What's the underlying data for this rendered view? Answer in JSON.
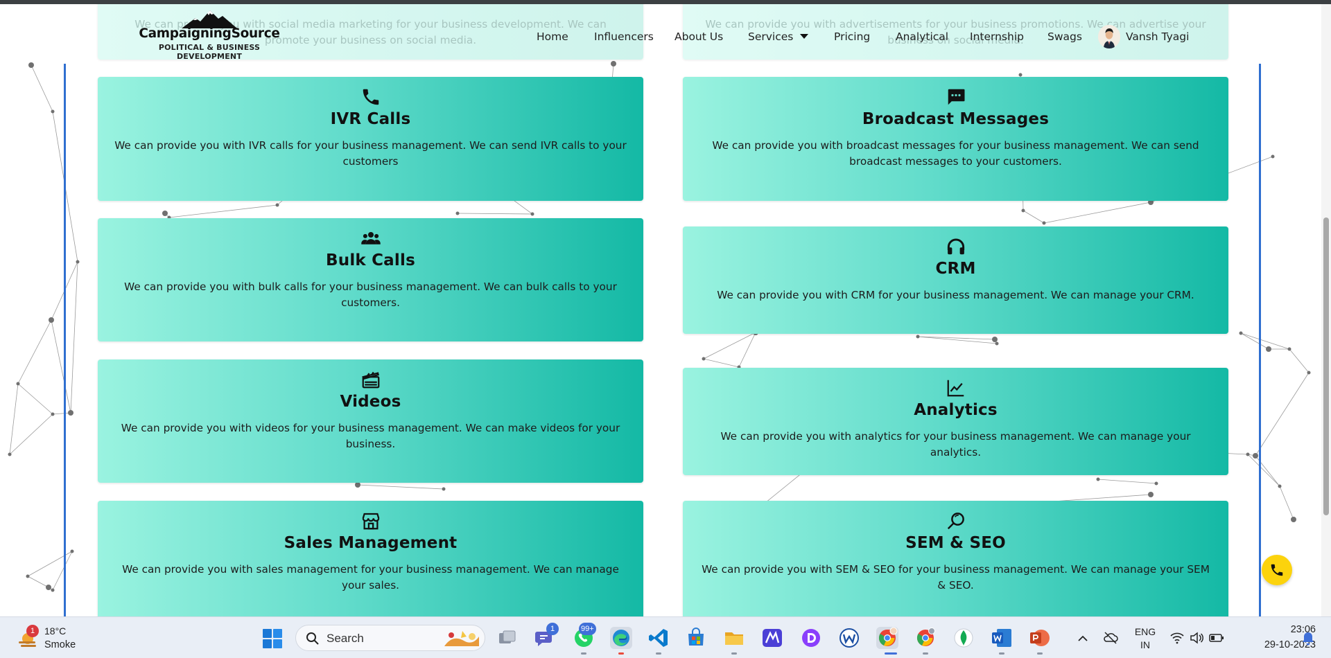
{
  "header": {
    "logo_brand": "CampaigningSource",
    "logo_tagline": "POLITICAL & BUSINESS DEVELOPMENT",
    "nav": {
      "home": "Home",
      "influencers": "Influencers",
      "about": "About Us",
      "services": "Services",
      "pricing": "Pricing",
      "analytical": "Analytical",
      "internship": "Internship",
      "swags": "Swags"
    },
    "user_name": "Vansh Tyagi"
  },
  "partial_cards": {
    "left": "We can provide you with social media marketing for your business development. We can promote your business on social media.",
    "right": "We can provide you with advertisements for your business promotions. We can advertise your business on social media."
  },
  "services": {
    "ivr": {
      "icon": "phone-icon",
      "title": "IVR Calls",
      "desc": "We can provide you with IVR calls for your business management. We can send IVR calls to your customers"
    },
    "broadcast": {
      "icon": "message-icon",
      "title": "Broadcast Messages",
      "desc": "We can provide you with broadcast messages for your business management. We can send broadcast messages to your customers."
    },
    "bulk": {
      "icon": "users-icon",
      "title": "Bulk Calls",
      "desc": "We can provide you with bulk calls for your business management. We can bulk calls to your customers."
    },
    "crm": {
      "icon": "headphones-icon",
      "title": "CRM",
      "desc": "We can provide you with CRM for your business management. We can manage your CRM."
    },
    "videos": {
      "icon": "clapperboard-icon",
      "title": "Videos",
      "desc": "We can provide you with videos for your business management. We can make videos for your business."
    },
    "analytics": {
      "icon": "chart-line-icon",
      "title": "Analytics",
      "desc": "We can provide you with analytics for your business management. We can manage your analytics."
    },
    "sales": {
      "icon": "store-icon",
      "title": "Sales Management",
      "desc": "We can provide you with sales management for your business management. We can manage your sales."
    },
    "sem": {
      "icon": "magnifier-icon",
      "title": "SEM & SEO",
      "desc": "We can provide you with SEM & SEO for your business management. We can manage your SEM & SEO."
    }
  },
  "colors": {
    "card_gradient_start": "#9af3e0",
    "card_gradient_end": "#14b9a5",
    "frame_blue": "#2f6fd0",
    "call_button": "#fcd30d",
    "taskbar": "#e9eef6"
  },
  "taskbar": {
    "weather_temp": "18°C",
    "weather_desc": "Smoke",
    "weather_badge": "1",
    "search_label": "Search",
    "teams_badge": "1",
    "whatsapp_badge": "99+",
    "lang_top": "ENG",
    "lang_bottom": "IN",
    "time": "23:06",
    "date": "29-10-2023"
  }
}
